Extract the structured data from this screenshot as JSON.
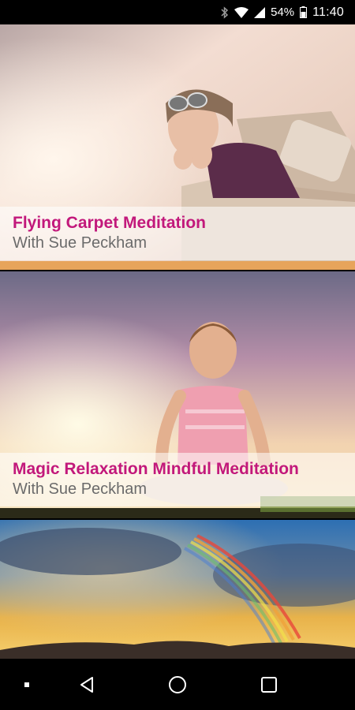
{
  "status_bar": {
    "battery_percent": "54%",
    "time": "11:40",
    "icons": [
      "bluetooth-icon",
      "wifi-icon",
      "signal-icon",
      "battery-icon"
    ]
  },
  "cards": [
    {
      "title": "Flying Carpet Meditation",
      "subtitle": "With Sue Peckham",
      "image": "child-in-cardboard-plane"
    },
    {
      "title": "Magic Relaxation Mindful Meditation",
      "subtitle": "With Sue Peckham",
      "image": "child-meditating-sunset"
    },
    {
      "image": "rainbow-sky"
    }
  ],
  "nav_bar": {
    "icons": [
      "menu-dot-icon",
      "back-icon",
      "home-icon",
      "recents-icon"
    ]
  },
  "colors": {
    "title": "#c2187b",
    "subtitle": "#6b6b6b"
  }
}
